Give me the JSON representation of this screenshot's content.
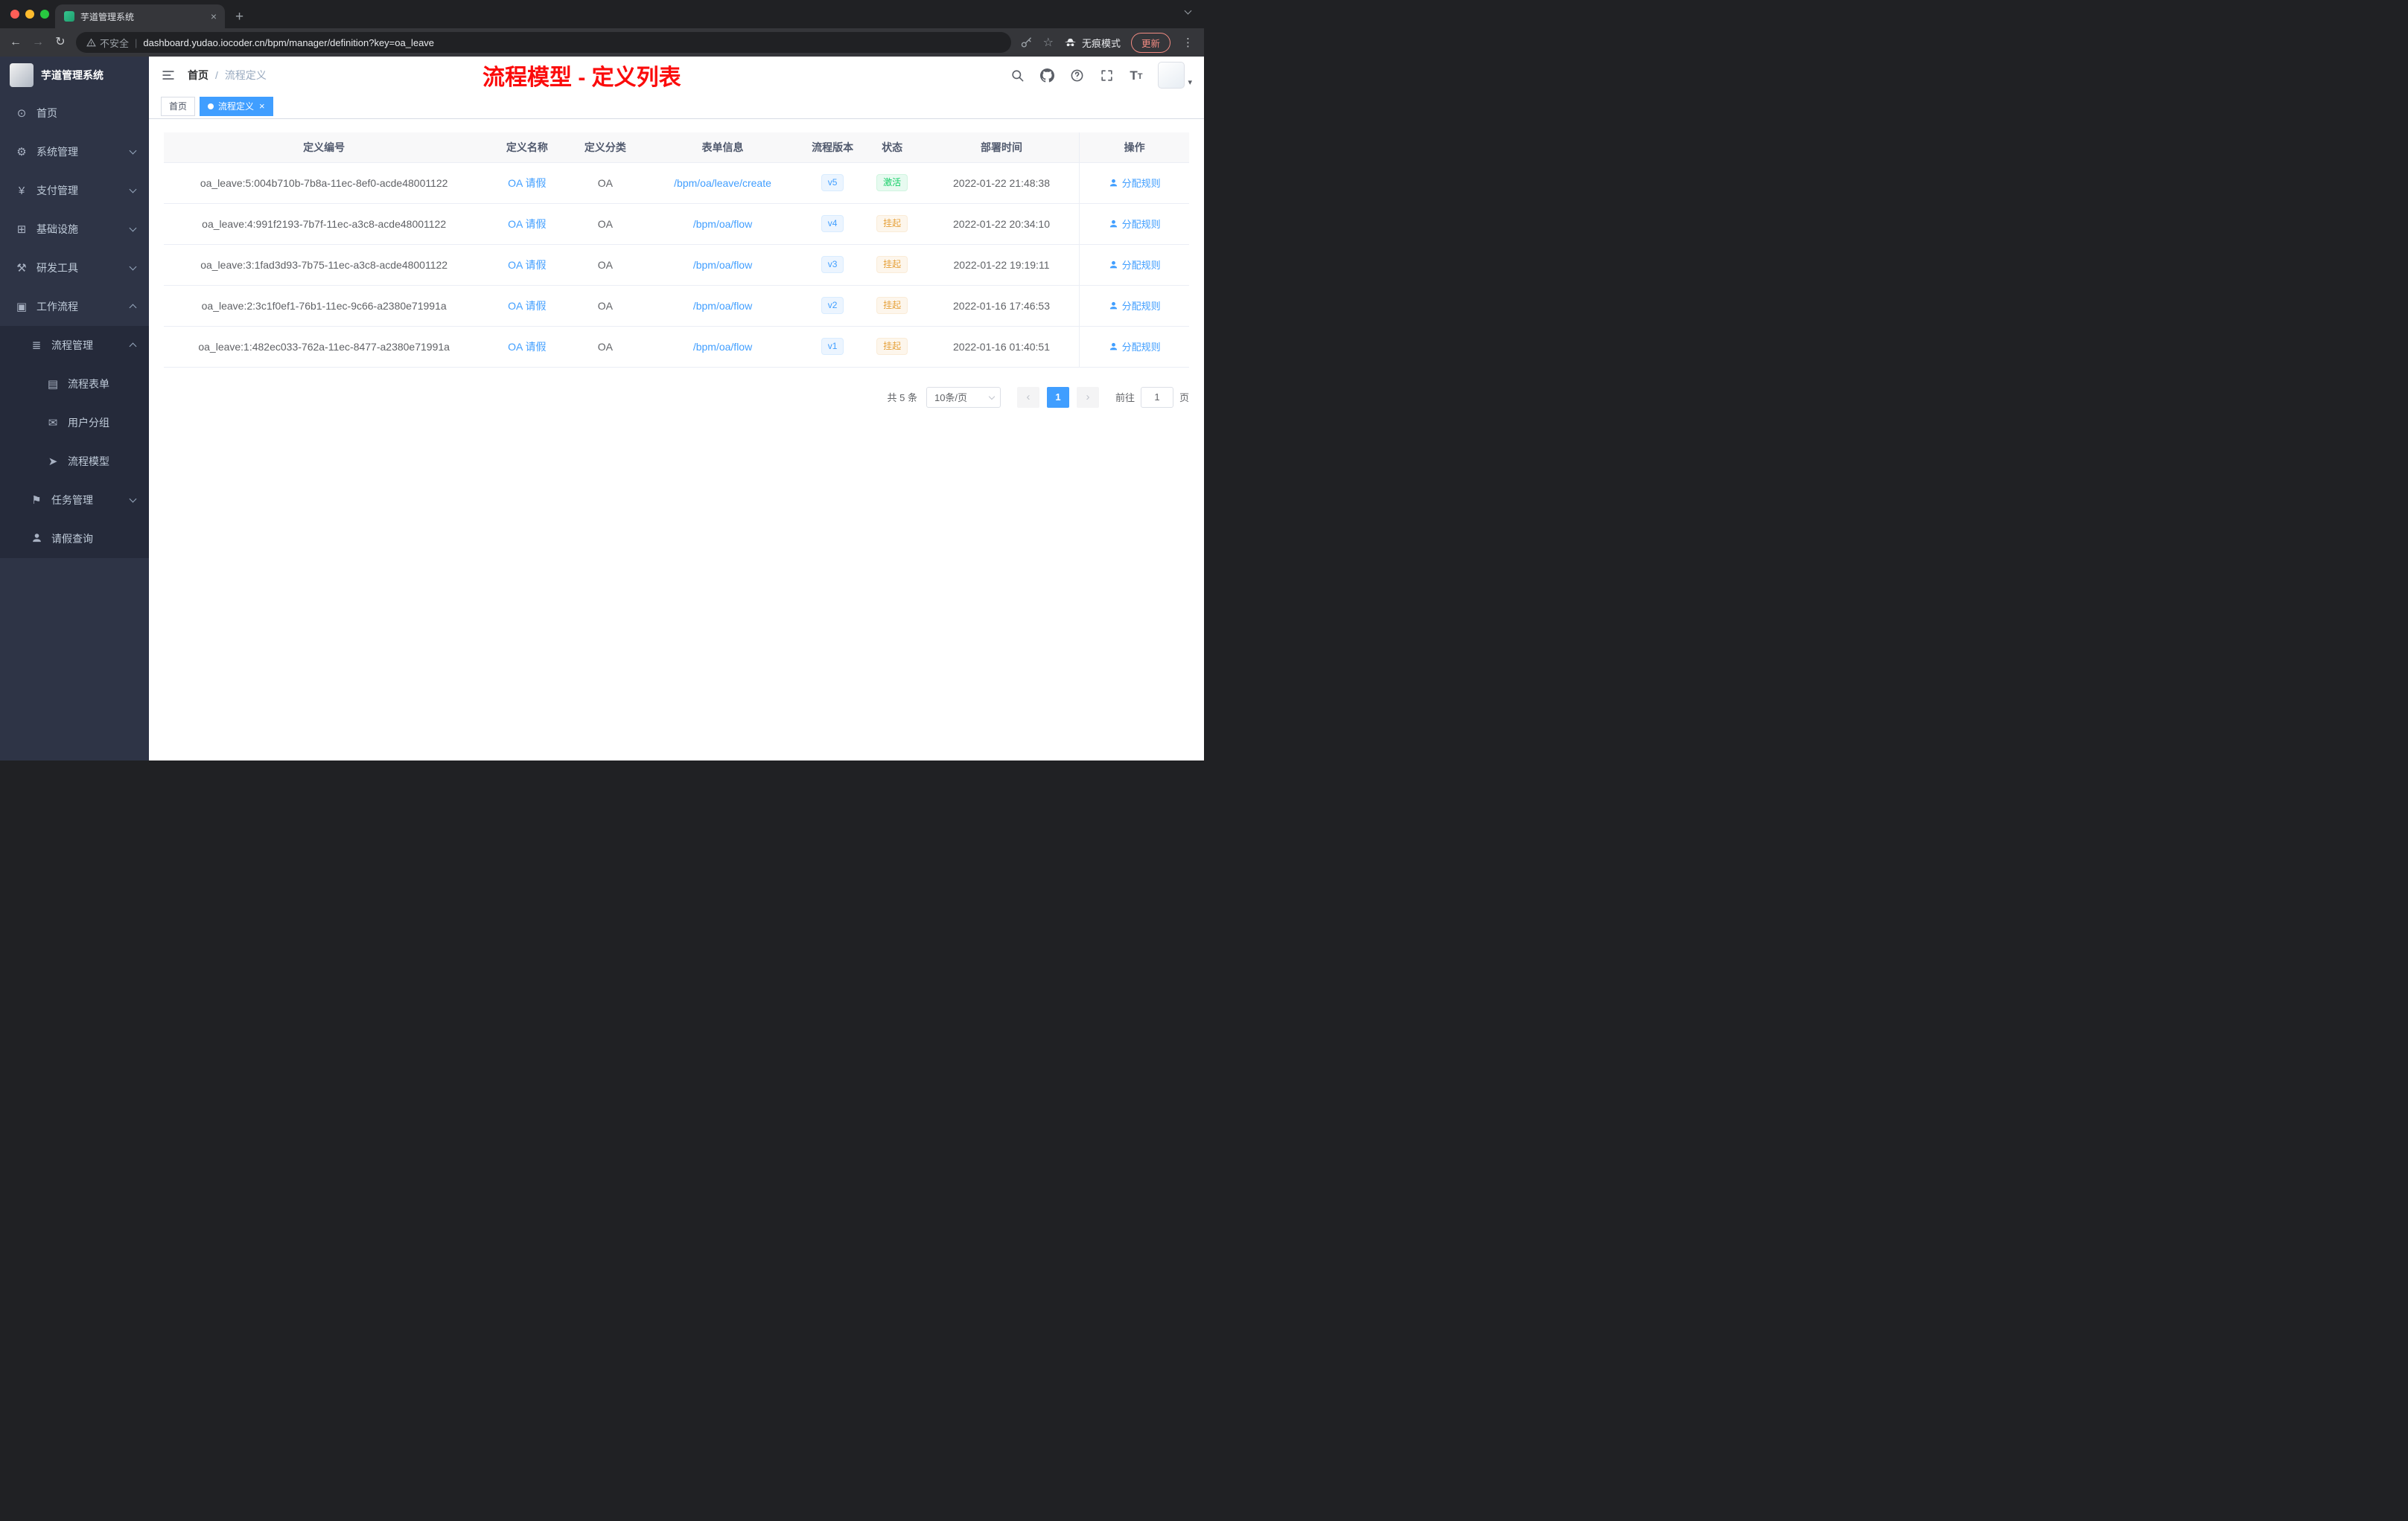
{
  "browser": {
    "tab_title": "芋道管理系统",
    "security_label": "不安全",
    "url_separator": "|",
    "url": "dashboard.yudao.iocoder.cn/bpm/manager/definition?key=oa_leave",
    "incognito_label": "无痕模式",
    "update_label": "更新"
  },
  "icons": {
    "close": "×",
    "plus": "+",
    "more_vertical": "⋮",
    "back": "←",
    "forward": "→",
    "reload": "↻",
    "star": "☆",
    "caret_down": "▾",
    "fontsize": "T",
    "prev": "‹",
    "next": "›",
    "home": "⊙",
    "gear": "⚙",
    "yen": "¥",
    "infra": "⊞",
    "tools": "⚒",
    "workflow": "▣",
    "process_mgmt": "≣",
    "form": "▤",
    "group": "✉",
    "model": "➤",
    "task": "⚑"
  },
  "sidebar": {
    "logo_title": "芋道管理系统",
    "items": [
      {
        "label": "首页"
      },
      {
        "label": "系统管理"
      },
      {
        "label": "支付管理"
      },
      {
        "label": "基础设施"
      },
      {
        "label": "研发工具"
      },
      {
        "label": "工作流程"
      },
      {
        "label": "流程管理"
      },
      {
        "label": "流程表单"
      },
      {
        "label": "用户分组"
      },
      {
        "label": "流程模型"
      },
      {
        "label": "任务管理"
      },
      {
        "label": "请假查询"
      }
    ]
  },
  "header": {
    "breadcrumb_home": "首页",
    "breadcrumb_separator": "/",
    "breadcrumb_current": "流程定义",
    "annotation": "流程模型 - 定义列表"
  },
  "tags": {
    "home": "首页",
    "active": "流程定义"
  },
  "table": {
    "columns": [
      "定义编号",
      "定义名称",
      "定义分类",
      "表单信息",
      "流程版本",
      "状态",
      "部署时间",
      "操作"
    ],
    "rows": [
      {
        "id": "oa_leave:5:004b710b-7b8a-11ec-8ef0-acde48001122",
        "name": "OA 请假",
        "category": "OA",
        "form": "/bpm/oa/leave/create",
        "version": "v5",
        "status": "激活",
        "deploy_time": "2022-01-22 21:48:38",
        "action": "分配规则"
      },
      {
        "id": "oa_leave:4:991f2193-7b7f-11ec-a3c8-acde48001122",
        "name": "OA 请假",
        "category": "OA",
        "form": "/bpm/oa/flow",
        "version": "v4",
        "status": "挂起",
        "deploy_time": "2022-01-22 20:34:10",
        "action": "分配规则"
      },
      {
        "id": "oa_leave:3:1fad3d93-7b75-11ec-a3c8-acde48001122",
        "name": "OA 请假",
        "category": "OA",
        "form": "/bpm/oa/flow",
        "version": "v3",
        "status": "挂起",
        "deploy_time": "2022-01-22 19:19:11",
        "action": "分配规则"
      },
      {
        "id": "oa_leave:2:3c1f0ef1-76b1-11ec-9c66-a2380e71991a",
        "name": "OA 请假",
        "category": "OA",
        "form": "/bpm/oa/flow",
        "version": "v2",
        "status": "挂起",
        "deploy_time": "2022-01-16 17:46:53",
        "action": "分配规则"
      },
      {
        "id": "oa_leave:1:482ec033-762a-11ec-8477-a2380e71991a",
        "name": "OA 请假",
        "category": "OA",
        "form": "/bpm/oa/flow",
        "version": "v1",
        "status": "挂起",
        "deploy_time": "2022-01-16 01:40:51",
        "action": "分配规则"
      }
    ]
  },
  "pagination": {
    "total": "共 5 条",
    "page_size": "10条/页",
    "page": "1",
    "goto": "前往",
    "goto_value": "1",
    "unit": "页"
  },
  "colors": {
    "accent": "#409eff",
    "status_active": "#13ce66",
    "status_suspended": "#e6a23c",
    "annotation_red": "#fb0b0b",
    "sidebar_bg": "#2e3446",
    "submenu_bg": "#252a3a"
  }
}
